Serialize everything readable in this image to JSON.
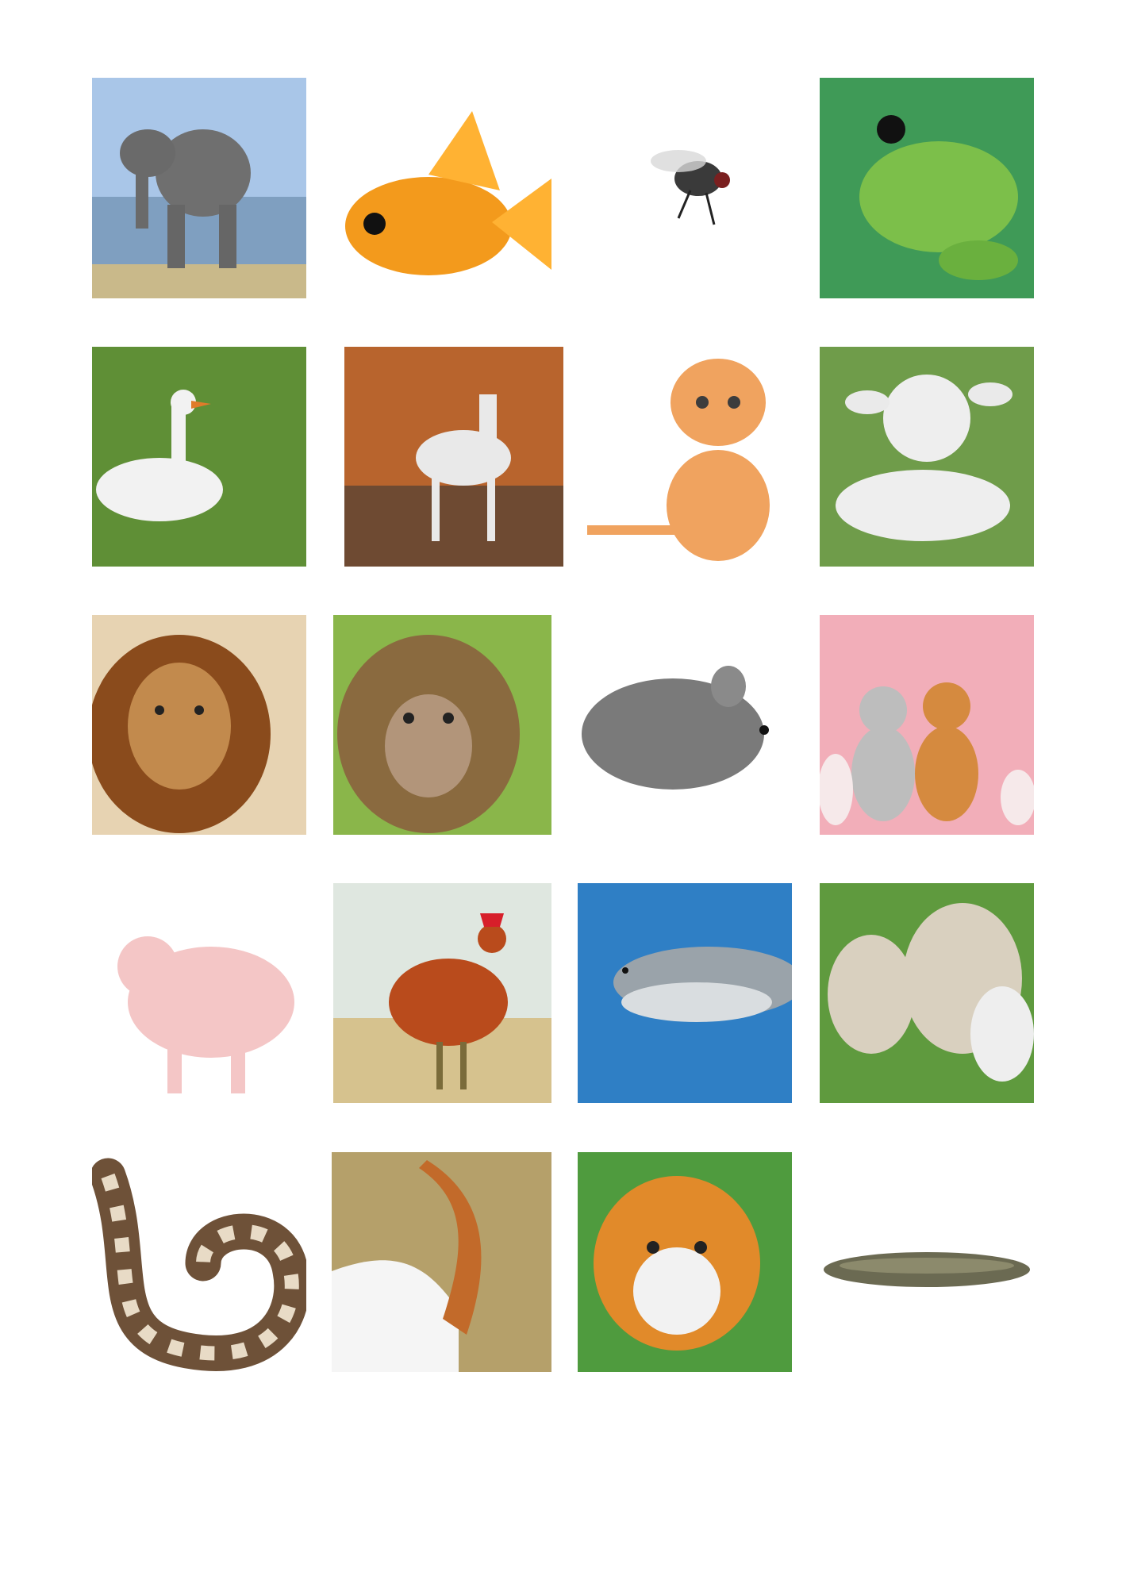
{
  "tiles": [
    {
      "icon": "elephant-photo",
      "colors": {
        "sky": "#a9c6e8",
        "water": "#7f9fc0",
        "ground": "#c9b98a",
        "body": "#6f6f6f"
      }
    },
    {
      "icon": "goldfish-photo",
      "colors": {
        "bg": "#ffffff",
        "body": "#f39a1c",
        "fin": "#ffb233"
      }
    },
    {
      "icon": "housefly-photo",
      "colors": {
        "bg": "#ffffff",
        "body": "#3a3a3a",
        "eye": "#7a1f1f"
      }
    },
    {
      "icon": "frog-photo",
      "colors": {
        "bg": "#3f9a57",
        "body": "#7cbf4a"
      }
    },
    {
      "icon": "goose-photo",
      "colors": {
        "grass": "#5f8f36",
        "body": "#f2f2f2",
        "beak": "#e07b2a"
      }
    },
    {
      "icon": "horse-photo",
      "colors": {
        "sky": "#b8642d",
        "ground": "#6e4a32",
        "body": "#e9e9e9"
      }
    },
    {
      "icon": "kitten-photo",
      "colors": {
        "bg": "#ffffff",
        "body": "#f0a35f"
      }
    },
    {
      "icon": "lamb-photo",
      "colors": {
        "grass": "#6f9c4a",
        "body": "#eeeeee"
      }
    },
    {
      "icon": "lion-photo",
      "colors": {
        "bg": "#e7d3b2",
        "mane": "#8a4b1c",
        "face": "#c28a4d"
      }
    },
    {
      "icon": "monkey-photo",
      "colors": {
        "bg": "#8ab64a",
        "body": "#8a6a3f"
      }
    },
    {
      "icon": "mouse-photo",
      "colors": {
        "bg": "#ffffff",
        "body": "#7a7a7a"
      }
    },
    {
      "icon": "dogs-on-pink-photo",
      "colors": {
        "bg": "#f2aeb9",
        "poodle": "#bdbdbd",
        "corgi": "#d58a3f"
      }
    },
    {
      "icon": "piglet-photo",
      "colors": {
        "bg": "#ffffff",
        "body": "#f4c6c6"
      }
    },
    {
      "icon": "rooster-photo",
      "colors": {
        "sky": "#dfe7e0",
        "ground": "#d6c28e",
        "body": "#b94b1c",
        "comb": "#d71f2a"
      }
    },
    {
      "icon": "shark-photo",
      "colors": {
        "water": "#2f7fc5",
        "body": "#9aa3aa"
      }
    },
    {
      "icon": "sheep-photo",
      "colors": {
        "grass": "#5f9a3e",
        "body": "#d9d0bf"
      }
    },
    {
      "icon": "snake-photo",
      "colors": {
        "bg": "#ffffff",
        "body": "#6e5138",
        "pattern": "#e8dbc6"
      }
    },
    {
      "icon": "dog-tail-photo",
      "colors": {
        "bg": "#b5a06a",
        "body": "#f5f5f5",
        "patch": "#c26a2a"
      }
    },
    {
      "icon": "tiger-photo",
      "colors": {
        "grass": "#4f9b3e",
        "body": "#e18a2a"
      }
    },
    {
      "icon": "caterpillar-photo",
      "colors": {
        "bg": "#ffffff",
        "body": "#6b6a52"
      }
    }
  ]
}
